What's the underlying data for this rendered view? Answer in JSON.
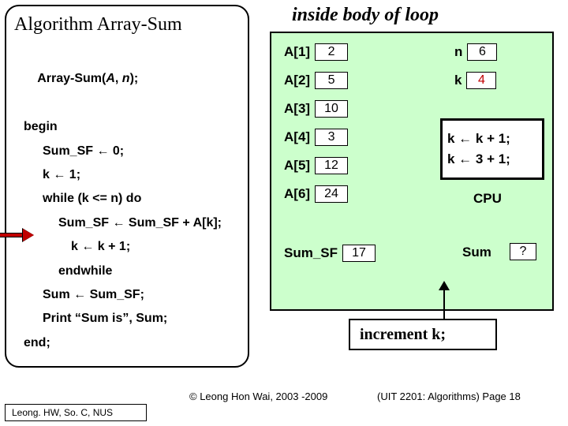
{
  "algo": {
    "title": "Algorithm Array-Sum",
    "sig_prefix": "Array-Sum(",
    "sig_A": "A",
    "sig_comma": ", ",
    "sig_n": "n",
    "sig_suffix": ");",
    "begin": "begin",
    "l1": "Sum_SF ← 0;",
    "l2": "k ← 1;",
    "l3": "while (k <= n) do",
    "l4": "Sum_SF ← Sum_SF + A[k];",
    "l5": "k ← k + 1;",
    "l6": "endwhile",
    "l7": "Sum ← Sum_SF;",
    "l8": "Print “Sum is”, Sum;",
    "end": "end;"
  },
  "loop_title": "inside body of loop",
  "array": {
    "labels": [
      "A[1]",
      "A[2]",
      "A[3]",
      "A[4]",
      "A[5]",
      "A[6]"
    ],
    "values": [
      "2",
      "5",
      "10",
      "3",
      "12",
      "24"
    ]
  },
  "vars": {
    "n_label": "n",
    "n_val": "6",
    "k_label": "k",
    "k_val": "4"
  },
  "cpu": {
    "line1": "k ← k + 1;",
    "line2": "k ← 3 + 1;",
    "label": "CPU"
  },
  "sumsf": {
    "label": "Sum_SF",
    "val": "17"
  },
  "sum": {
    "label": "Sum",
    "val": "?"
  },
  "increment": "increment k;",
  "copyright": "© Leong Hon Wai, 2003 -2009",
  "pagefoot": "(UIT 2201: Algorithms) Page 18",
  "author": "Leong. HW, So. C, NUS"
}
